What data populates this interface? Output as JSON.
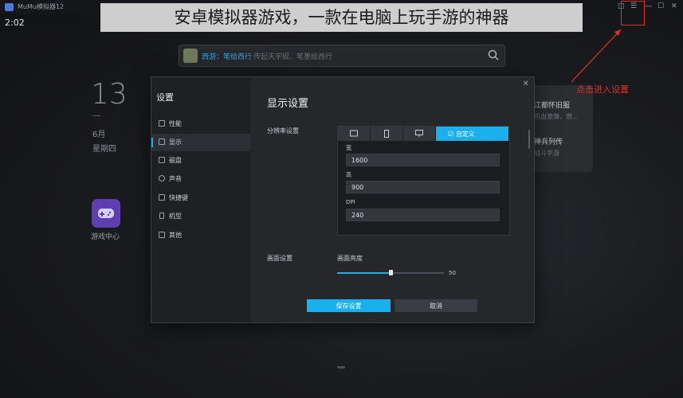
{
  "window": {
    "title": "MuMu模拟器12"
  },
  "status": {
    "time": "2:02"
  },
  "caption": {
    "text": "安卓模拟器游戏，一款在电脑上玩手游的神器"
  },
  "annotation": {
    "note": "点击进入设置",
    "color": "#e3302a"
  },
  "search": {
    "user": "西游：笔绘西行",
    "placeholder": "传起天宇砚，笔墨绘西行"
  },
  "home": {
    "day": "13",
    "month": "6月",
    "weekday": "星期四",
    "apps": [
      {
        "label": "游戏中心",
        "icon": "gamepad-icon"
      }
    ],
    "news": [
      {
        "title": "江都怀旧服",
        "sub": "热血激情，燃..."
      },
      {
        "title": "神兵列传",
        "sub": "战斗手游"
      }
    ]
  },
  "settings": {
    "title": "设置",
    "nav": [
      {
        "label": "性能",
        "icon": "performance-icon"
      },
      {
        "label": "显示",
        "icon": "display-icon",
        "active": true
      },
      {
        "label": "磁盘",
        "icon": "disk-icon"
      },
      {
        "label": "声音",
        "icon": "sound-icon"
      },
      {
        "label": "快捷键",
        "icon": "keyboard-icon"
      },
      {
        "label": "机型",
        "icon": "phone-icon"
      },
      {
        "label": "其他",
        "icon": "grid-icon"
      }
    ],
    "section_title": "显示设置",
    "resolution": {
      "label": "分辨率设置",
      "tabs": [
        {
          "icon": "tablet-landscape-icon"
        },
        {
          "icon": "phone-portrait-icon"
        },
        {
          "icon": "monitor-icon"
        },
        {
          "label": "自定义",
          "icon": "edit-icon",
          "active": true
        }
      ],
      "width_label": "宽",
      "width_value": "1600",
      "height_label": "高",
      "height_value": "900",
      "dpi_label": "DPI",
      "dpi_value": "240"
    },
    "screen": {
      "label": "画面设置",
      "brightness_label": "画面亮度",
      "brightness_value": "50",
      "brightness_max": 100
    },
    "buttons": {
      "save": "保存设置",
      "cancel": "取消"
    },
    "accent": "#1ab0ee"
  }
}
